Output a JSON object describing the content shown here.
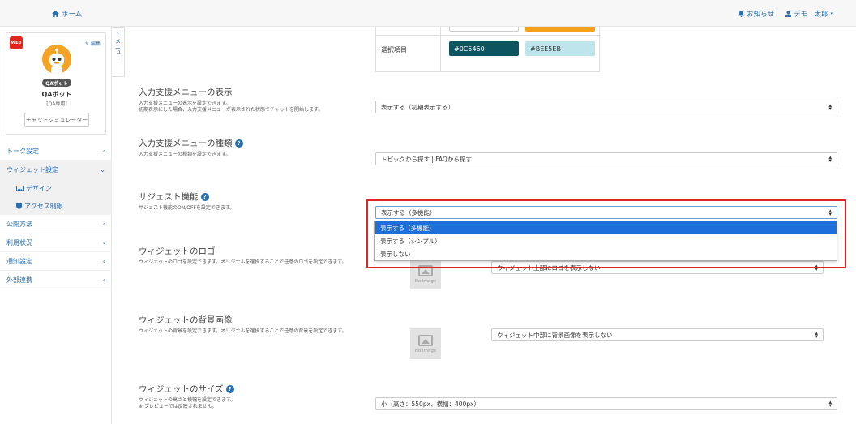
{
  "topbar": {
    "home": "ホーム",
    "notifications": "お知らせ",
    "user": "デモ　太郎"
  },
  "profile": {
    "web_badge": "WEB",
    "edit": "編集",
    "bot_badge": "QAボット",
    "bot_name": "QAボット",
    "bot_sub": "[QA専用]",
    "sim_button": "チャットシミュレーター"
  },
  "collapse_tab": {
    "label": "メニュー"
  },
  "nav": {
    "talk": "トーク設定",
    "widget": "ウィジェット設定",
    "design": "デザイン",
    "access": "アクセス制限",
    "publish": "公開方法",
    "usage": "利用状況",
    "notify": "通知設定",
    "external": "外部連携"
  },
  "colors": {
    "row_label": "選択項目",
    "dark_hex": "#0C5460",
    "light_hex": "#BEE5EB",
    "accent_orange": "#F5A11A"
  },
  "sections": {
    "input_menu_display": {
      "title": "入力支援メニューの表示",
      "desc1": "入力支援メニューの表示を設定できます。",
      "desc2": "初期表示にした場合、入力支援メニューが表示された状態でチャットを開始します。",
      "value": "表示する（初期表示する）"
    },
    "input_menu_type": {
      "title": "入力支援メニューの種類",
      "desc1": "入力支援メニューの種類を設定できます。",
      "value": "トピックから探す | FAQから探す"
    },
    "suggest": {
      "title": "サジェスト機能",
      "desc1": "サジェスト機能のON/OFFを設定できます。",
      "value": "表示する（多機能）",
      "options": [
        "表示する（多機能）",
        "表示する（シンプル）",
        "表示しない"
      ]
    },
    "logo": {
      "title": "ウィジェットのロゴ",
      "desc1": "ウィジェットのロゴを設定できます。オリジナルを選択することで任意のロゴを設定できます。",
      "no_image": "No Image",
      "value": "ウィジェット上部にロゴを表示しない"
    },
    "bg": {
      "title": "ウィジェットの背景画像",
      "desc1": "ウィジェットの背景を設定できます。オリジナルを選択することで任意の背景を設定できます。",
      "no_image": "No Image",
      "value": "ウィジェット中部に背景画像を表示しない"
    },
    "size": {
      "title": "ウィジェットのサイズ",
      "desc1": "ウィジェットの高さと横幅を設定できます。",
      "desc2": "※ プレビューでは反映されません。",
      "value": "小（高さ：550px、横幅：400px）"
    }
  }
}
